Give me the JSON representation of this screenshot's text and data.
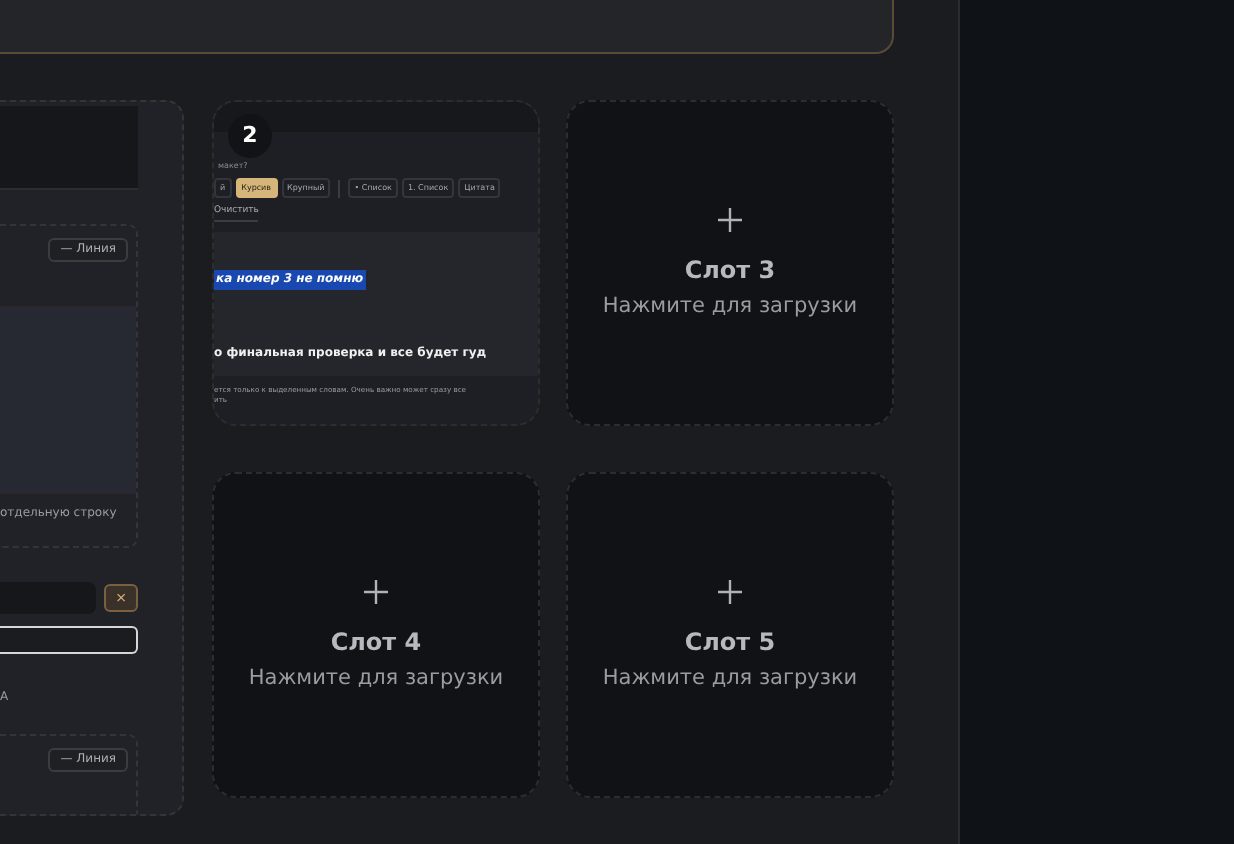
{
  "editor_panel": {
    "line_button_top": "— Линия",
    "preview_caption": "отдельную строку",
    "remove_button": "×",
    "letter": "А",
    "line_button_bottom": "— Линия"
  },
  "slots": [
    {
      "kind": "filled",
      "number": "2",
      "preview": {
        "caption": "макет?",
        "toolbar": [
          {
            "label": "й",
            "selected": false
          },
          {
            "label": "Курсив",
            "selected": true
          },
          {
            "label": "Крупный",
            "selected": false
          },
          {
            "label": "• Список",
            "selected": false
          },
          {
            "label": "1. Список",
            "selected": false
          },
          {
            "label": "Цитата",
            "selected": false
          }
        ],
        "clear_button": "Очистить",
        "highlighted_line": "ка номер 3 не помню",
        "bold_line": "о финальная проверка и все будет гуд",
        "footer": "ется только к выделенным словам. Очень важно может сразу все",
        "footer_end": "ить"
      }
    },
    {
      "kind": "empty",
      "title": "Слот 3",
      "hint": "Нажмите для загрузки"
    },
    {
      "kind": "empty",
      "title": "Слот 4",
      "hint": "Нажмите для загрузки"
    },
    {
      "kind": "empty",
      "title": "Слот 5",
      "hint": "Нажмите для загрузки"
    }
  ]
}
